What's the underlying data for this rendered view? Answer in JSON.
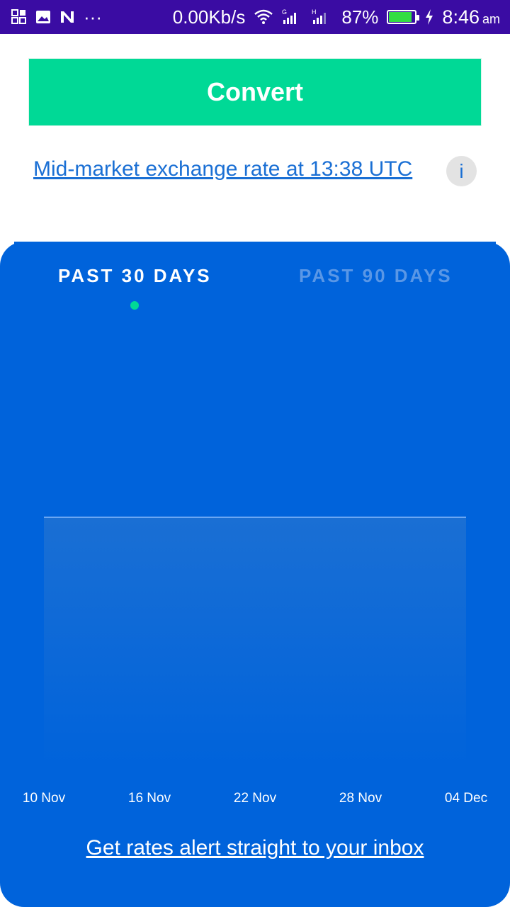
{
  "status_bar": {
    "network_speed": "0.00Kb/s",
    "battery_percent": "87%",
    "battery_level": 0.87,
    "time": "8:46",
    "ampm": "am",
    "sim1_label": "G",
    "sim2_label": "H",
    "more": "···",
    "icons": [
      "notification-grid-icon",
      "image-icon",
      "n-app-icon",
      "wifi-icon",
      "signal-icon",
      "battery-icon",
      "charging-icon"
    ]
  },
  "convert_button": {
    "label": "Convert"
  },
  "rate_info": {
    "link_text": "Mid-market exchange rate at 13:38 UTC",
    "info_symbol": "i"
  },
  "chart_tabs": [
    {
      "label": "PAST 30 DAYS",
      "active": true
    },
    {
      "label": "PAST 90 DAYS",
      "active": false
    }
  ],
  "chart_data": {
    "type": "area",
    "categories": [
      "10 Nov",
      "16 Nov",
      "22 Nov",
      "28 Nov",
      "04 Dec"
    ],
    "values": [
      1,
      1,
      1,
      1,
      1
    ],
    "ylim": [
      0,
      1.8
    ],
    "title": "",
    "xlabel": "",
    "ylabel": "",
    "grid": false,
    "colors": {
      "line": "#6aa6f2",
      "fill_top": "#1a6fd4",
      "fill_bottom": "#0063db",
      "background": "#0063db"
    }
  },
  "alert_link": {
    "text": "Get rates alert straight to your inbox"
  },
  "colors": {
    "status_bar": "#3a0ca3",
    "accent_green": "#00d996",
    "link_blue": "#1a6fd4",
    "card_blue": "#0063db"
  }
}
